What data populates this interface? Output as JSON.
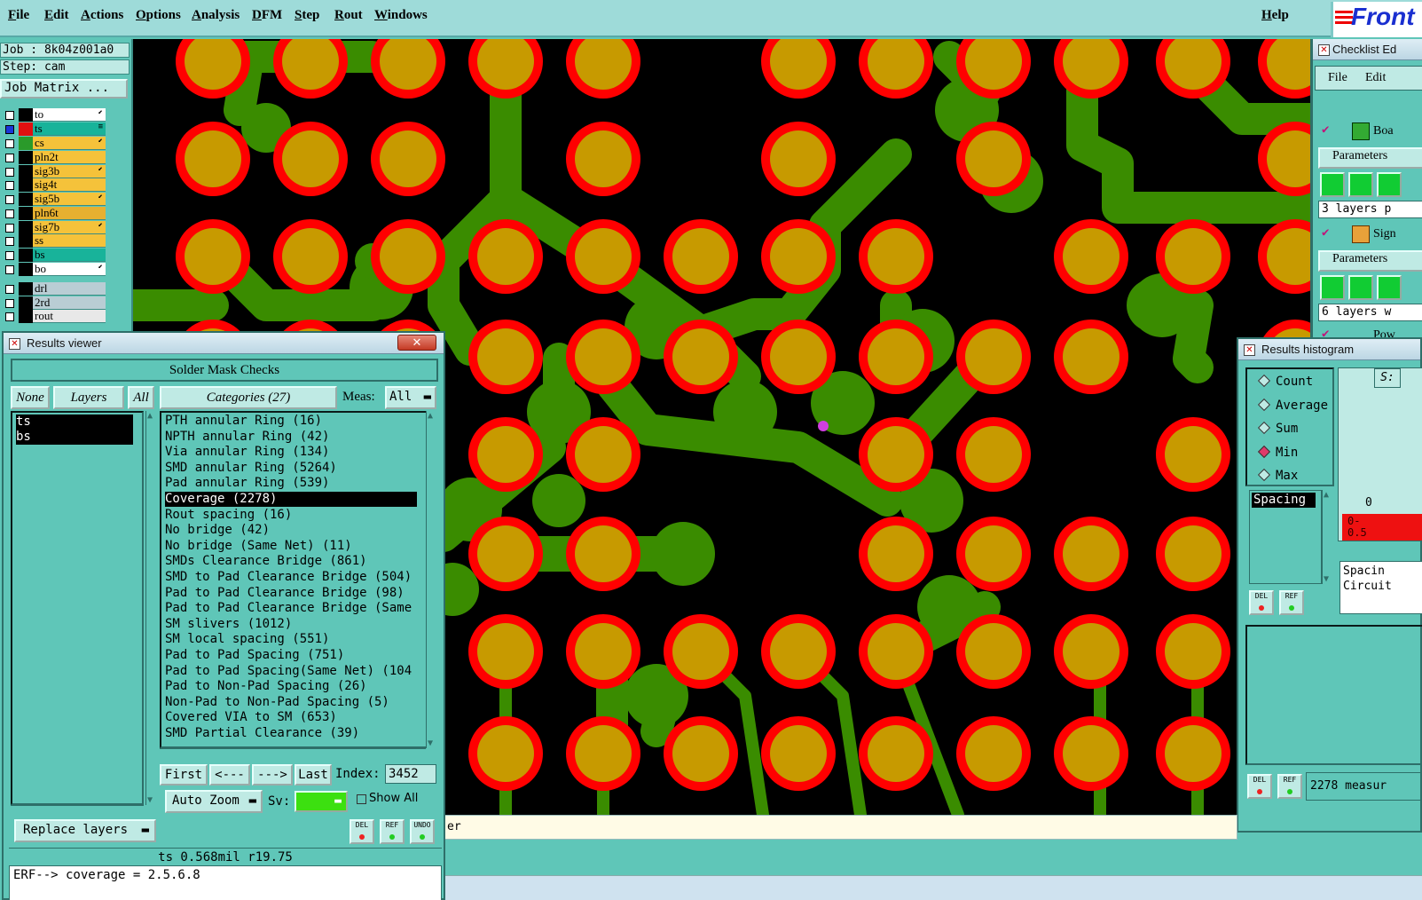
{
  "menu": {
    "items": [
      "File",
      "Edit",
      "Actions",
      "Options",
      "Analysis",
      "DFM",
      "Step",
      "Rout",
      "Windows"
    ],
    "help": "Help"
  },
  "logo": "Front",
  "job": {
    "job_label": "Job : 8k04z001a0",
    "step_label": "Step: cam",
    "matrix_button": "Job Matrix ..."
  },
  "layers": [
    {
      "name": "to",
      "color": "#ffffff",
      "marker": "⬋"
    },
    {
      "name": "ts",
      "color": "#18b39a",
      "marker": "≡"
    },
    {
      "name": "cs",
      "color": "#f5c23a",
      "marker": "⬋"
    },
    {
      "name": "pln2t",
      "color": "#f5c23a",
      "marker": ""
    },
    {
      "name": "sig3b",
      "color": "#f5c23a",
      "marker": "⬋"
    },
    {
      "name": "sig4t",
      "color": "#f5c23a",
      "marker": ""
    },
    {
      "name": "sig5b",
      "color": "#f5c23a",
      "marker": "⬋"
    },
    {
      "name": "pln6t",
      "color": "#e6b030",
      "marker": ""
    },
    {
      "name": "sig7b",
      "color": "#f5c23a",
      "marker": "⬋"
    },
    {
      "name": "ss",
      "color": "#f5c23a",
      "marker": ""
    },
    {
      "name": "bs",
      "color": "#18b39a",
      "marker": ""
    },
    {
      "name": "bo",
      "color": "#ffffff",
      "marker": "⬋"
    },
    {
      "name": "drl",
      "color": "#b9cdd4",
      "marker": ""
    },
    {
      "name": "2rd",
      "color": "#b9cdd4",
      "marker": ""
    },
    {
      "name": "rout",
      "color": "#e8e8e8",
      "marker": ""
    }
  ],
  "results_viewer": {
    "title": "Results viewer",
    "close": "✕",
    "header": "Solder Mask Checks",
    "tab_none": "None",
    "tab_layers": "Layers",
    "tab_all": "All",
    "categories_label": "Categories (27)",
    "meas_label": "Meas:",
    "meas_value": "All",
    "layer_list": [
      "ts",
      "bs"
    ],
    "categories": [
      "PTH annular Ring (16)",
      "NPTH annular Ring (42)",
      "Via annular Ring (134)",
      "SMD annular Ring (5264)",
      "Pad annular Ring (539)",
      "Coverage (2278)",
      "Rout spacing (16)",
      "No bridge (42)",
      "No bridge (Same Net) (11)",
      "SMDs Clearance Bridge (861)",
      "SMD to Pad Clearance Bridge (504)",
      "Pad to Pad Clearance Bridge (98)",
      "Pad to Pad Clearance Bridge (Same",
      "SM slivers (1012)",
      "SM local spacing (551)",
      "Pad to Pad Spacing (751)",
      "Pad to Pad Spacing(Same Net) (104",
      "Pad to Non-Pad Spacing (26)",
      "Non-Pad to Non-Pad Spacing (5)",
      "Covered VIA to SM (653)",
      "SMD Partial Clearance (39)"
    ],
    "selected_index": 5,
    "nav": {
      "first": "First",
      "prev": "<---",
      "next": "--->",
      "last": "Last",
      "index_label": "Index:",
      "index_value": "3452"
    },
    "auto_zoom": "Auto Zoom",
    "sv_label": "Sv:",
    "show_all": "Show All",
    "replace_layers": "Replace layers",
    "btn_del": "DEL",
    "btn_ref": "REF",
    "btn_undo": "UNDO",
    "info_line": "ts 0.568mil   r19.75",
    "erf_line": "ERF--> coverage = 2.5.6.8"
  },
  "histogram": {
    "title": "Results histogram",
    "options": [
      "Count",
      "Average",
      "Sum",
      "Min",
      "Max"
    ],
    "selected": "Min",
    "list_item": "Spacing",
    "axis_zero": "0",
    "bin_label": "0-\n0.5",
    "info1": "Spacin",
    "info2": "Circuit",
    "measure_text": "2278 measur",
    "corner": "S:"
  },
  "checklist": {
    "title": "Checklist Ed",
    "menu_file": "File",
    "menu_edit": "Edit",
    "row1": "Boa",
    "params": "Parameters",
    "layers1": "3 layers p",
    "row2": "Sign",
    "layers2": "6 layers w",
    "row3": "Pow"
  },
  "status": {
    "text": "er"
  },
  "colors": {
    "pad_ring": "#ff0000",
    "pad_fill": "#c79a00",
    "trace": "#3a8c00",
    "panel": "#5fc6b8",
    "accent": "#1a2fd0"
  }
}
